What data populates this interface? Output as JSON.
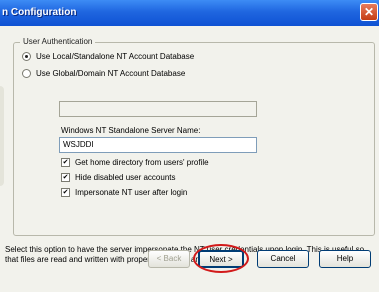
{
  "window": {
    "title": "n Configuration",
    "close_glyph": "✕"
  },
  "group": {
    "legend": "User Authentication",
    "options": [
      {
        "label": "Use Local/Standalone NT Account Database",
        "selected": true
      },
      {
        "label": "Use Global/Domain NT Account Database",
        "selected": false
      }
    ],
    "domain_field_value": "",
    "server_label": "Windows NT Standalone Server Name:",
    "server_value": "WSJDDI",
    "checkboxes": [
      {
        "label": "Get home directory from users' profile",
        "checked": true
      },
      {
        "label": "Hide disabled user accounts",
        "checked": true
      },
      {
        "label": "Impersonate NT user after login",
        "checked": true
      }
    ]
  },
  "description": "Select this option to have the server impersonate the NT user credentials upon login. This is useful so that files are read and written with proper ownership and rights.",
  "buttons": {
    "back": "< Back",
    "next": "Next >",
    "cancel": "Cancel",
    "help": "Help"
  },
  "colors": {
    "titlebar": "#0f52d3",
    "highlight_ring": "#d21a1a"
  }
}
